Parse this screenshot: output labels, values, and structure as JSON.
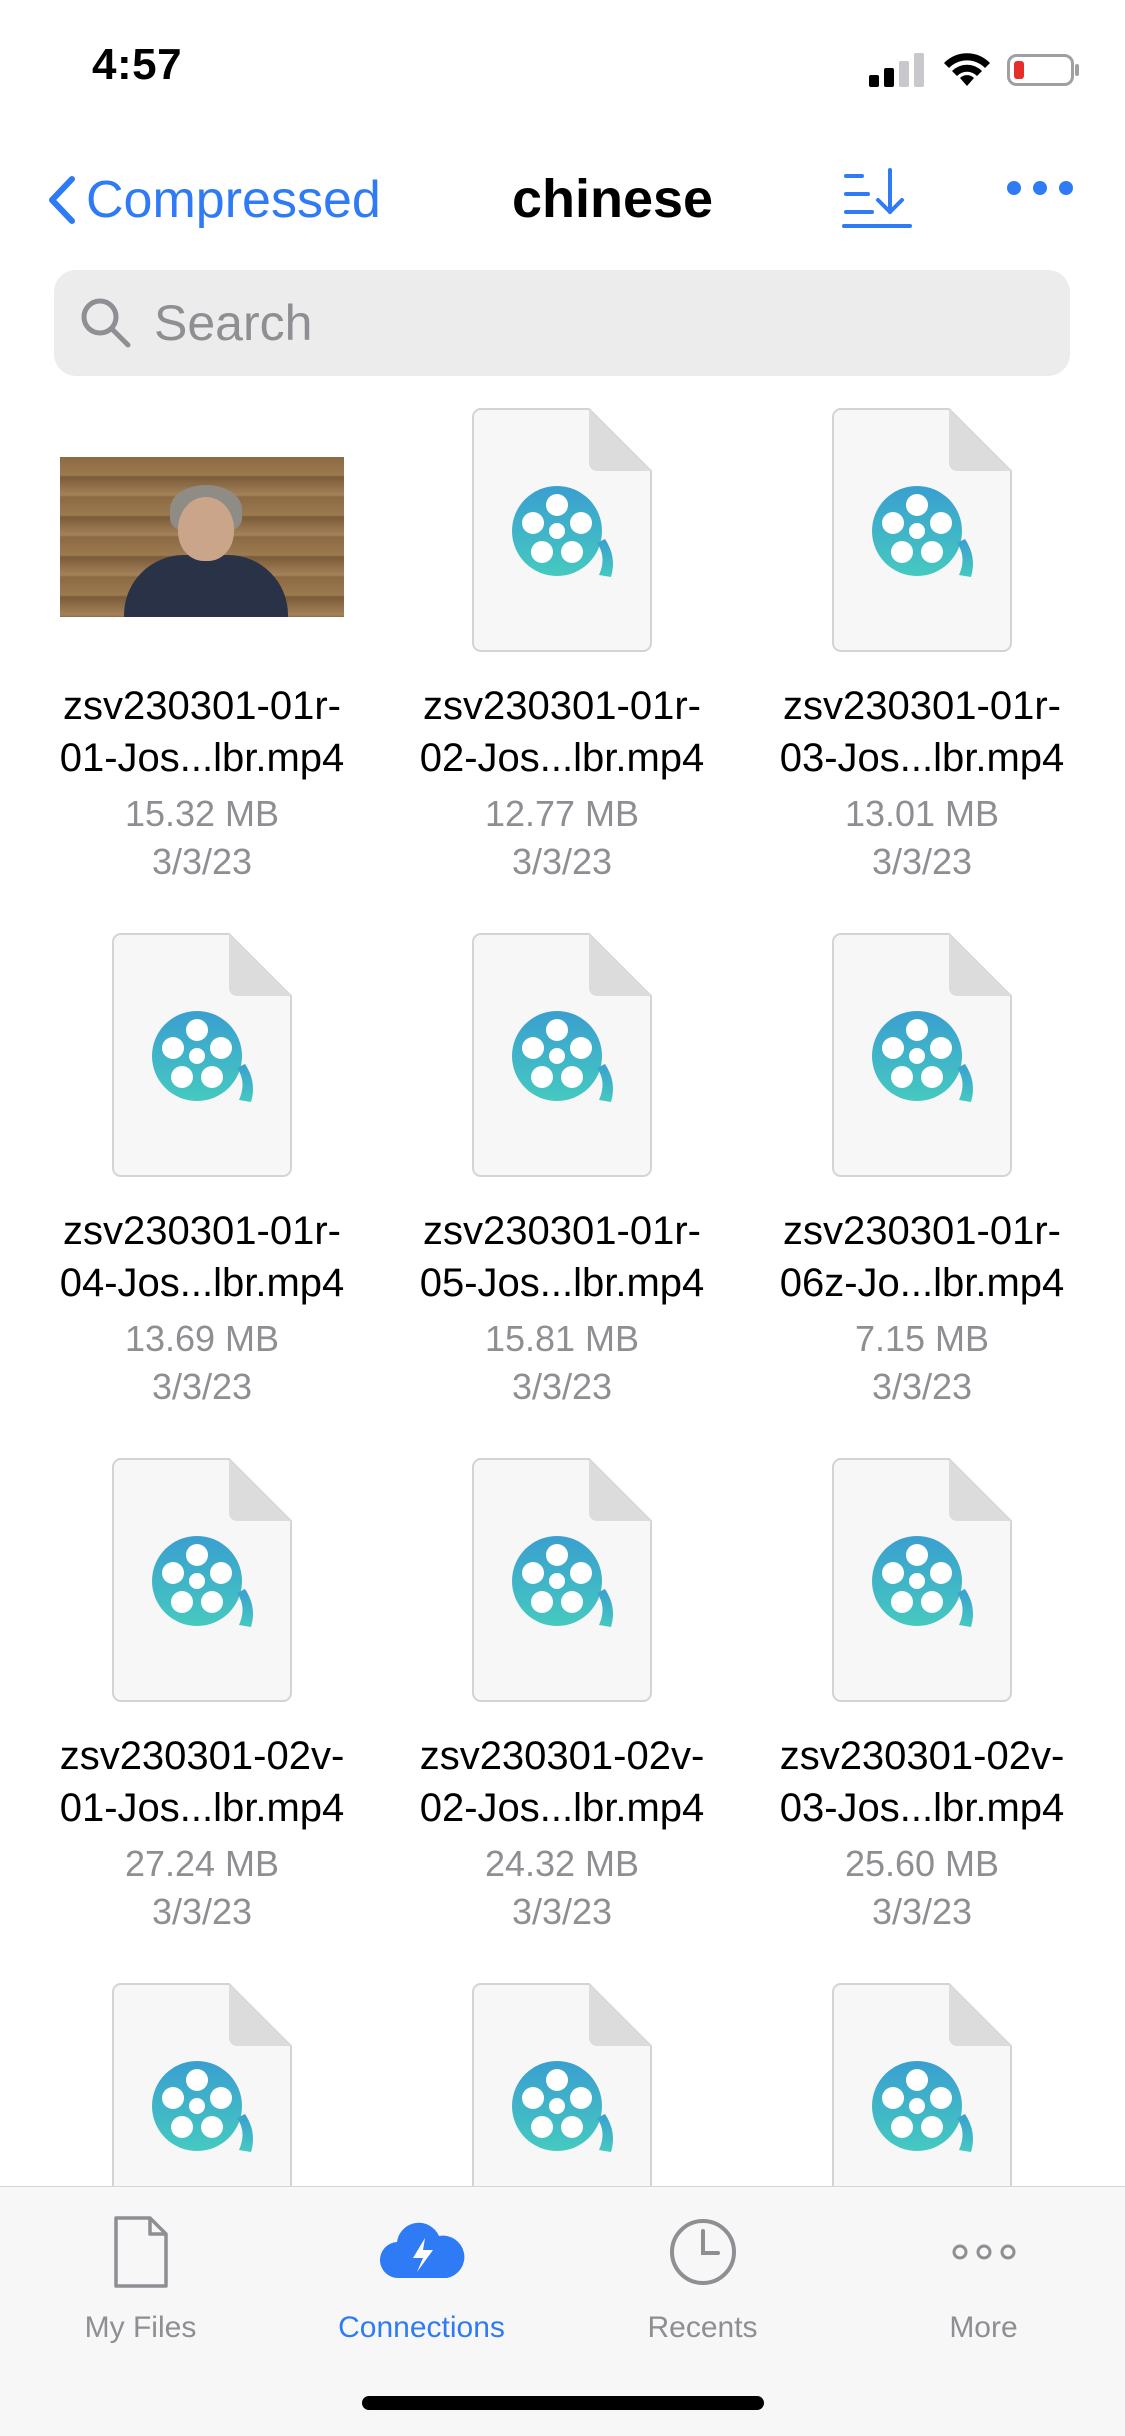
{
  "status_bar": {
    "time": "4:57"
  },
  "nav": {
    "back_label": "Compressed",
    "title": "chinese"
  },
  "search": {
    "placeholder": "Search"
  },
  "colors": {
    "accent": "#2f7bf6",
    "icon_teal": "#3bb3c8"
  },
  "files": [
    {
      "name_line1": "zsv230301-01r-",
      "name_line2": "01-Jos...lbr.mp4",
      "size": "15.32 MB",
      "date": "3/3/23",
      "thumbnail": "video-frame"
    },
    {
      "name_line1": "zsv230301-01r-",
      "name_line2": "02-Jos...lbr.mp4",
      "size": "12.77 MB",
      "date": "3/3/23",
      "thumbnail": "video-file-icon"
    },
    {
      "name_line1": "zsv230301-01r-",
      "name_line2": "03-Jos...lbr.mp4",
      "size": "13.01 MB",
      "date": "3/3/23",
      "thumbnail": "video-file-icon"
    },
    {
      "name_line1": "zsv230301-01r-",
      "name_line2": "04-Jos...lbr.mp4",
      "size": "13.69 MB",
      "date": "3/3/23",
      "thumbnail": "video-file-icon"
    },
    {
      "name_line1": "zsv230301-01r-",
      "name_line2": "05-Jos...lbr.mp4",
      "size": "15.81 MB",
      "date": "3/3/23",
      "thumbnail": "video-file-icon"
    },
    {
      "name_line1": "zsv230301-01r-",
      "name_line2": "06z-Jo...lbr.mp4",
      "size": "7.15 MB",
      "date": "3/3/23",
      "thumbnail": "video-file-icon"
    },
    {
      "name_line1": "zsv230301-02v-",
      "name_line2": "01-Jos...lbr.mp4",
      "size": "27.24 MB",
      "date": "3/3/23",
      "thumbnail": "video-file-icon"
    },
    {
      "name_line1": "zsv230301-02v-",
      "name_line2": "02-Jos...lbr.mp4",
      "size": "24.32 MB",
      "date": "3/3/23",
      "thumbnail": "video-file-icon"
    },
    {
      "name_line1": "zsv230301-02v-",
      "name_line2": "03-Jos...lbr.mp4",
      "size": "25.60 MB",
      "date": "3/3/23",
      "thumbnail": "video-file-icon"
    },
    {
      "name_line1": "",
      "name_line2": "",
      "size": "",
      "date": "",
      "thumbnail": "video-file-icon"
    },
    {
      "name_line1": "",
      "name_line2": "",
      "size": "",
      "date": "",
      "thumbnail": "video-file-icon"
    },
    {
      "name_line1": "",
      "name_line2": "",
      "size": "",
      "date": "",
      "thumbnail": "video-file-icon"
    }
  ],
  "tabs": [
    {
      "label": "My Files",
      "icon": "document-icon",
      "active": false
    },
    {
      "label": "Connections",
      "icon": "cloud-bolt-icon",
      "active": true
    },
    {
      "label": "Recents",
      "icon": "clock-icon",
      "active": false
    },
    {
      "label": "More",
      "icon": "ellipsis-icon",
      "active": false
    }
  ]
}
